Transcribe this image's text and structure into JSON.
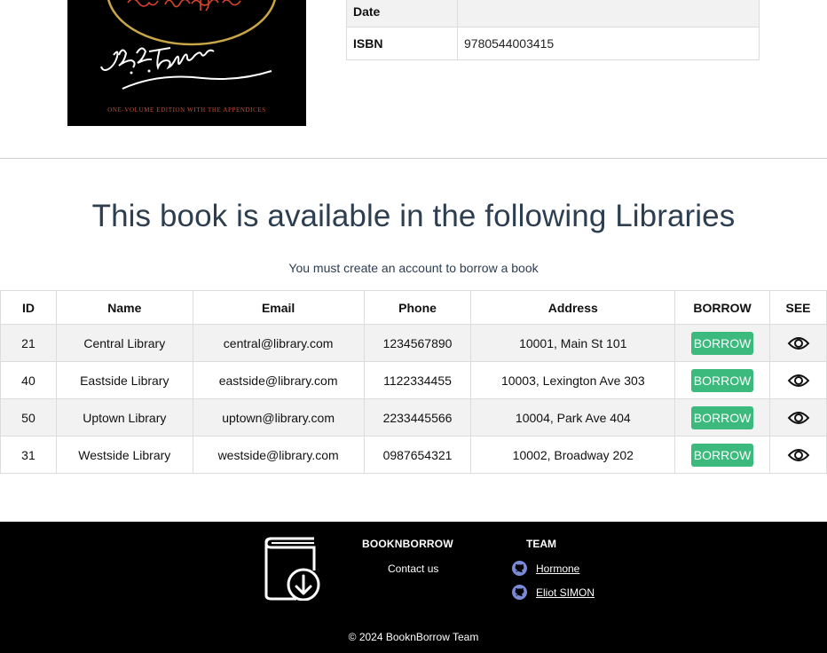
{
  "book": {
    "cover_caption": "ONE-VOLUME EDITION WITH THE APPENDICES",
    "details": [
      {
        "label": "Date",
        "value": ""
      },
      {
        "label": "ISBN",
        "value": "9780544003415"
      }
    ]
  },
  "libraries_section": {
    "title": "This book is available in the following Libraries",
    "notice": "You must create an account to borrow a book",
    "columns": [
      "ID",
      "Name",
      "Email",
      "Phone",
      "Address",
      "BORROW",
      "SEE"
    ],
    "borrow_label": "BORROW",
    "rows": [
      {
        "id": "21",
        "name": "Central Library",
        "email": "central@library.com",
        "phone": "1234567890",
        "address": "10001, Main St 101"
      },
      {
        "id": "40",
        "name": "Eastside Library",
        "email": "eastside@library.com",
        "phone": "1122334455",
        "address": "10003, Lexington Ave 303"
      },
      {
        "id": "50",
        "name": "Uptown Library",
        "email": "uptown@library.com",
        "phone": "2233445566",
        "address": "10004, Park Ave 404"
      },
      {
        "id": "31",
        "name": "Westside Library",
        "email": "westside@library.com",
        "phone": "0987654321",
        "address": "10002, Broadway 202"
      }
    ]
  },
  "footer": {
    "brand_title": "BOOKNBORROW",
    "contact_label": "Contact us",
    "team_title": "TEAM",
    "team": [
      {
        "name": "Hormone",
        "icon": "github-icon"
      },
      {
        "name": "Eliot SIMON",
        "icon": "github-icon"
      }
    ],
    "copyright": "© 2024 BooknBorrow Team"
  },
  "colors": {
    "heading": "#2c3e50",
    "borrow_button": "#3cb97d",
    "footer_bg": "#000000",
    "github_icon": "#7b8ad6"
  }
}
